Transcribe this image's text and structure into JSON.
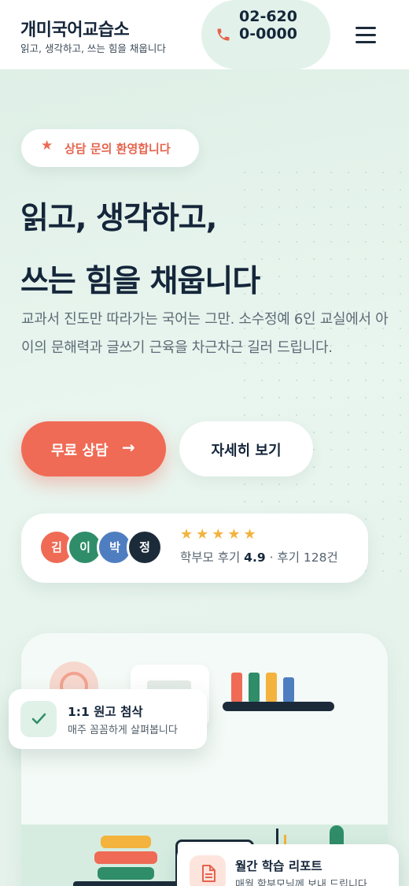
{
  "header": {
    "brand_name": "개미국어교습소",
    "tagline": "읽고, 생각하고, 쓰는 힘을 채웁니다",
    "phone_number": "02-6200-0000",
    "menu_icon": "hamburger-icon",
    "phone_icon": "phone-icon"
  },
  "hero": {
    "badge": "상담 문의 환영합니다",
    "badge_icon": "star-icon",
    "title_line1": "읽고, 생각하고,",
    "title_line2": "쓰는 힘을 채웁니다",
    "description": "교과서 진도만 따라가는 국어는 그만. 소수정예 6인 교실에서 아이의 문해력과 글쓰기 근육을 차근차근 길러 드립니다.",
    "primary_button": "무료 상담",
    "primary_arrow": "→",
    "secondary_button": "자세히 보기"
  },
  "reviews": {
    "avatars": [
      {
        "initial": "김",
        "color": "#ef6b55"
      },
      {
        "initial": "이",
        "color": "#2f8d6a"
      },
      {
        "initial": "박",
        "color": "#4f7ec0"
      },
      {
        "initial": "정",
        "color": "#1c2b3a"
      }
    ],
    "stars": "★★★★★",
    "rating_count": 5,
    "label_prefix": "학부모 후기",
    "rating": "4.9",
    "label_suffix": "· 후기 128건"
  },
  "cards": {
    "feedback": {
      "title": "1:1 원고 첨삭",
      "subtitle": "매주 꼼꼼하게 살펴봅니다",
      "icon": "check-icon"
    },
    "report": {
      "title": "월간 학습 리포트",
      "subtitle": "매월 학부모님께 보내 드립니다",
      "icon": "document-icon"
    }
  },
  "colors": {
    "accent": "#ef6b55",
    "dark": "#15263a",
    "mint_bg": "#e3f1ea",
    "star": "#f3b33d"
  }
}
